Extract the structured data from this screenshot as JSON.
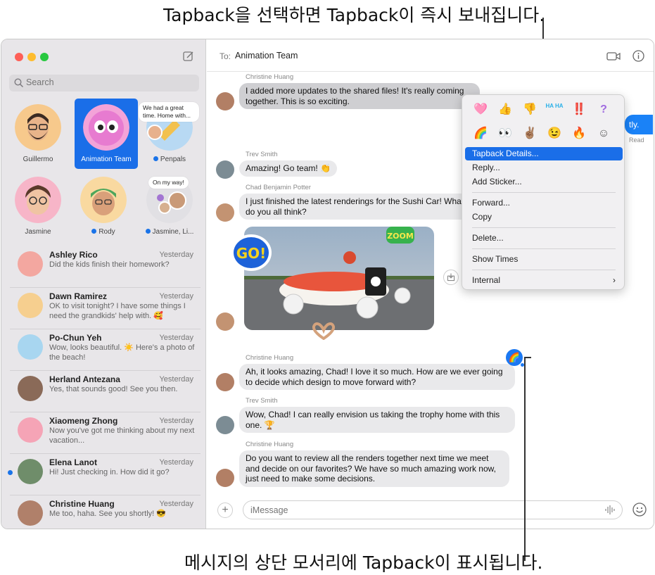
{
  "captions": {
    "top": "Tapback을 선택하면 Tapback이 즉시 보내집니다.",
    "bottom": "메시지의 상단 모서리에 Tapback이 표시됩니다."
  },
  "sidebar": {
    "search_placeholder": "Search",
    "pinned": [
      {
        "label": "Guillermo",
        "unread": false
      },
      {
        "label": "Animation Team",
        "unread": false,
        "selected": true
      },
      {
        "label": "Penpals",
        "unread": true,
        "bubble": "We had a great time. Home with..."
      },
      {
        "label": "Jasmine",
        "unread": false
      },
      {
        "label": "Rody",
        "unread": true
      },
      {
        "label": "Jasmine, Li...",
        "unread": true,
        "bubble": "On my way!"
      }
    ],
    "conversations": [
      {
        "name": "Ashley Rico",
        "time": "Yesterday",
        "preview": "Did the kids finish their homework?",
        "unread": false
      },
      {
        "name": "Dawn Ramirez",
        "time": "Yesterday",
        "preview": "OK to visit tonight? I have some things I need the grandkids' help with. 🥰",
        "unread": false
      },
      {
        "name": "Po-Chun Yeh",
        "time": "Yesterday",
        "preview": "Wow, looks beautiful. ☀️ Here's a photo of the beach!",
        "unread": false
      },
      {
        "name": "Herland Antezana",
        "time": "Yesterday",
        "preview": "Yes, that sounds good! See you then.",
        "unread": false
      },
      {
        "name": "Xiaomeng Zhong",
        "time": "Yesterday",
        "preview": "Now you've got me thinking about my next vacation...",
        "unread": false
      },
      {
        "name": "Elena Lanot",
        "time": "Yesterday",
        "preview": "Hi! Just checking in. How did it go?",
        "unread": true
      },
      {
        "name": "Christine Huang",
        "time": "Yesterday",
        "preview": "Me too, haha. See you shortly! 😎",
        "unread": false
      }
    ]
  },
  "chat": {
    "to_label": "To:",
    "to_name": "Animation Team",
    "messages": [
      {
        "sender": "Christine Huang",
        "text": "I added more updates to the shared files! It's really coming together. This is so exciting."
      },
      {
        "sender": "Trev Smith",
        "text": "Amazing! Go team! 👏"
      },
      {
        "sender": "Chad Benjamin Potter",
        "text": "I just finished the latest renderings for the Sushi Car! What do you all think?"
      },
      {
        "sender": "Christine Huang",
        "text": "Ah, it looks amazing, Chad! I love it so much. How are we ever going to decide which design to move forward with?"
      },
      {
        "sender": "Trev Smith",
        "text": "Wow, Chad! I can really envision us taking the trophy home with this one. 🏆"
      },
      {
        "sender": "Christine Huang",
        "text": "Do you want to review all the renders together next time we meet and decide on our favorites? We have so much amazing work now, just need to make some decisions."
      }
    ],
    "me_partial": "tly.",
    "read_label": "Read",
    "stickers": {
      "go": "GO!",
      "zoom": "ZOOM"
    },
    "tapback_badge": "🌈",
    "compose_placeholder": "iMessage"
  },
  "context_menu": {
    "tapbacks": [
      "🩷",
      "👍",
      "👎",
      "HA HA",
      "‼️",
      "?",
      "🌈",
      "👀",
      "✌🏽",
      "😉",
      "🔥",
      "☺"
    ],
    "items": [
      {
        "label": "Tapback Details...",
        "active": true
      },
      {
        "label": "Reply..."
      },
      {
        "label": "Add Sticker..."
      },
      {
        "label": "Forward..."
      },
      {
        "label": "Copy"
      },
      {
        "label": "Delete..."
      },
      {
        "label": "Show Times"
      },
      {
        "label": "Internal",
        "chevron": "›"
      }
    ]
  },
  "colors": {
    "accent": "#1a6ee8",
    "sidebar_bg": "#e8e6e9",
    "bubble_gray": "#e9e9eb",
    "bubble_blue": "#1a82f7"
  }
}
